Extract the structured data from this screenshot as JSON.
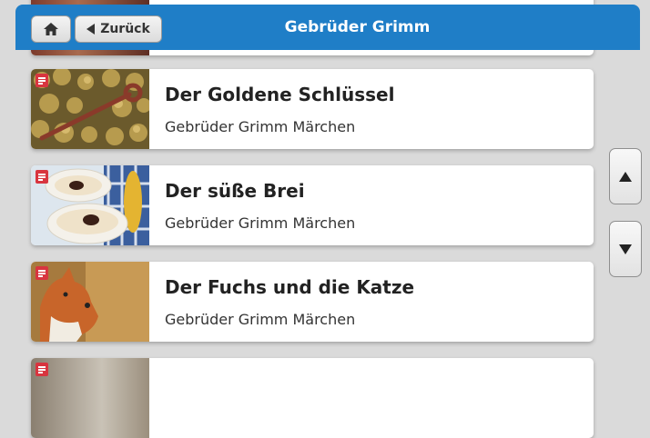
{
  "header": {
    "title": "Gebrüder Grimm",
    "back_label": "Zurück",
    "home_icon": "home-icon",
    "color": "#1f7ec7"
  },
  "stories": [
    {
      "title": "",
      "subtitle": "",
      "icon": "document-icon"
    },
    {
      "title": "Der Goldene Schlüssel",
      "subtitle": "Gebrüder Grimm Märchen",
      "icon": "document-icon"
    },
    {
      "title": "Der süße Brei",
      "subtitle": "Gebrüder Grimm Märchen",
      "icon": "document-icon"
    },
    {
      "title": "Der Fuchs und die Katze",
      "subtitle": "Gebrüder Grimm Märchen",
      "icon": "document-icon"
    },
    {
      "title": "",
      "subtitle": "",
      "icon": "document-icon"
    }
  ],
  "scroll": {
    "up_icon": "arrow-up-icon",
    "down_icon": "arrow-down-icon"
  },
  "colors": {
    "badge": "#d8353f",
    "background": "#dadada"
  }
}
